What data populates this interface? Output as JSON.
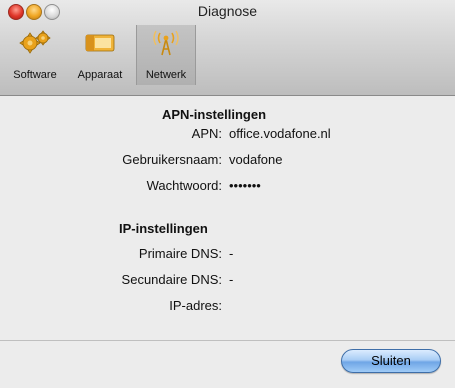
{
  "window": {
    "title": "Diagnose",
    "accent_color": "#6fa6e6"
  },
  "toolbar": {
    "items": [
      {
        "label": "Software",
        "icon": "gears-icon",
        "active": false
      },
      {
        "label": "Apparaat",
        "icon": "device-icon",
        "active": false
      },
      {
        "label": "Netwerk",
        "icon": "antenna-icon",
        "active": true
      }
    ]
  },
  "apn": {
    "heading": "APN-instellingen",
    "apn_label": "APN:",
    "apn_value": "office.vodafone.nl",
    "username_label": "Gebruikersnaam:",
    "username_value": "vodafone",
    "password_label": "Wachtwoord:",
    "password_value": "•••••••"
  },
  "ip": {
    "heading": "IP-instellingen",
    "dns1_label": "Primaire DNS:",
    "dns1_value": "-",
    "dns2_label": "Secundaire DNS:",
    "dns2_value": "-",
    "ip_label": "IP-adres:",
    "ip_value": ""
  },
  "footer": {
    "close_label": "Sluiten"
  }
}
